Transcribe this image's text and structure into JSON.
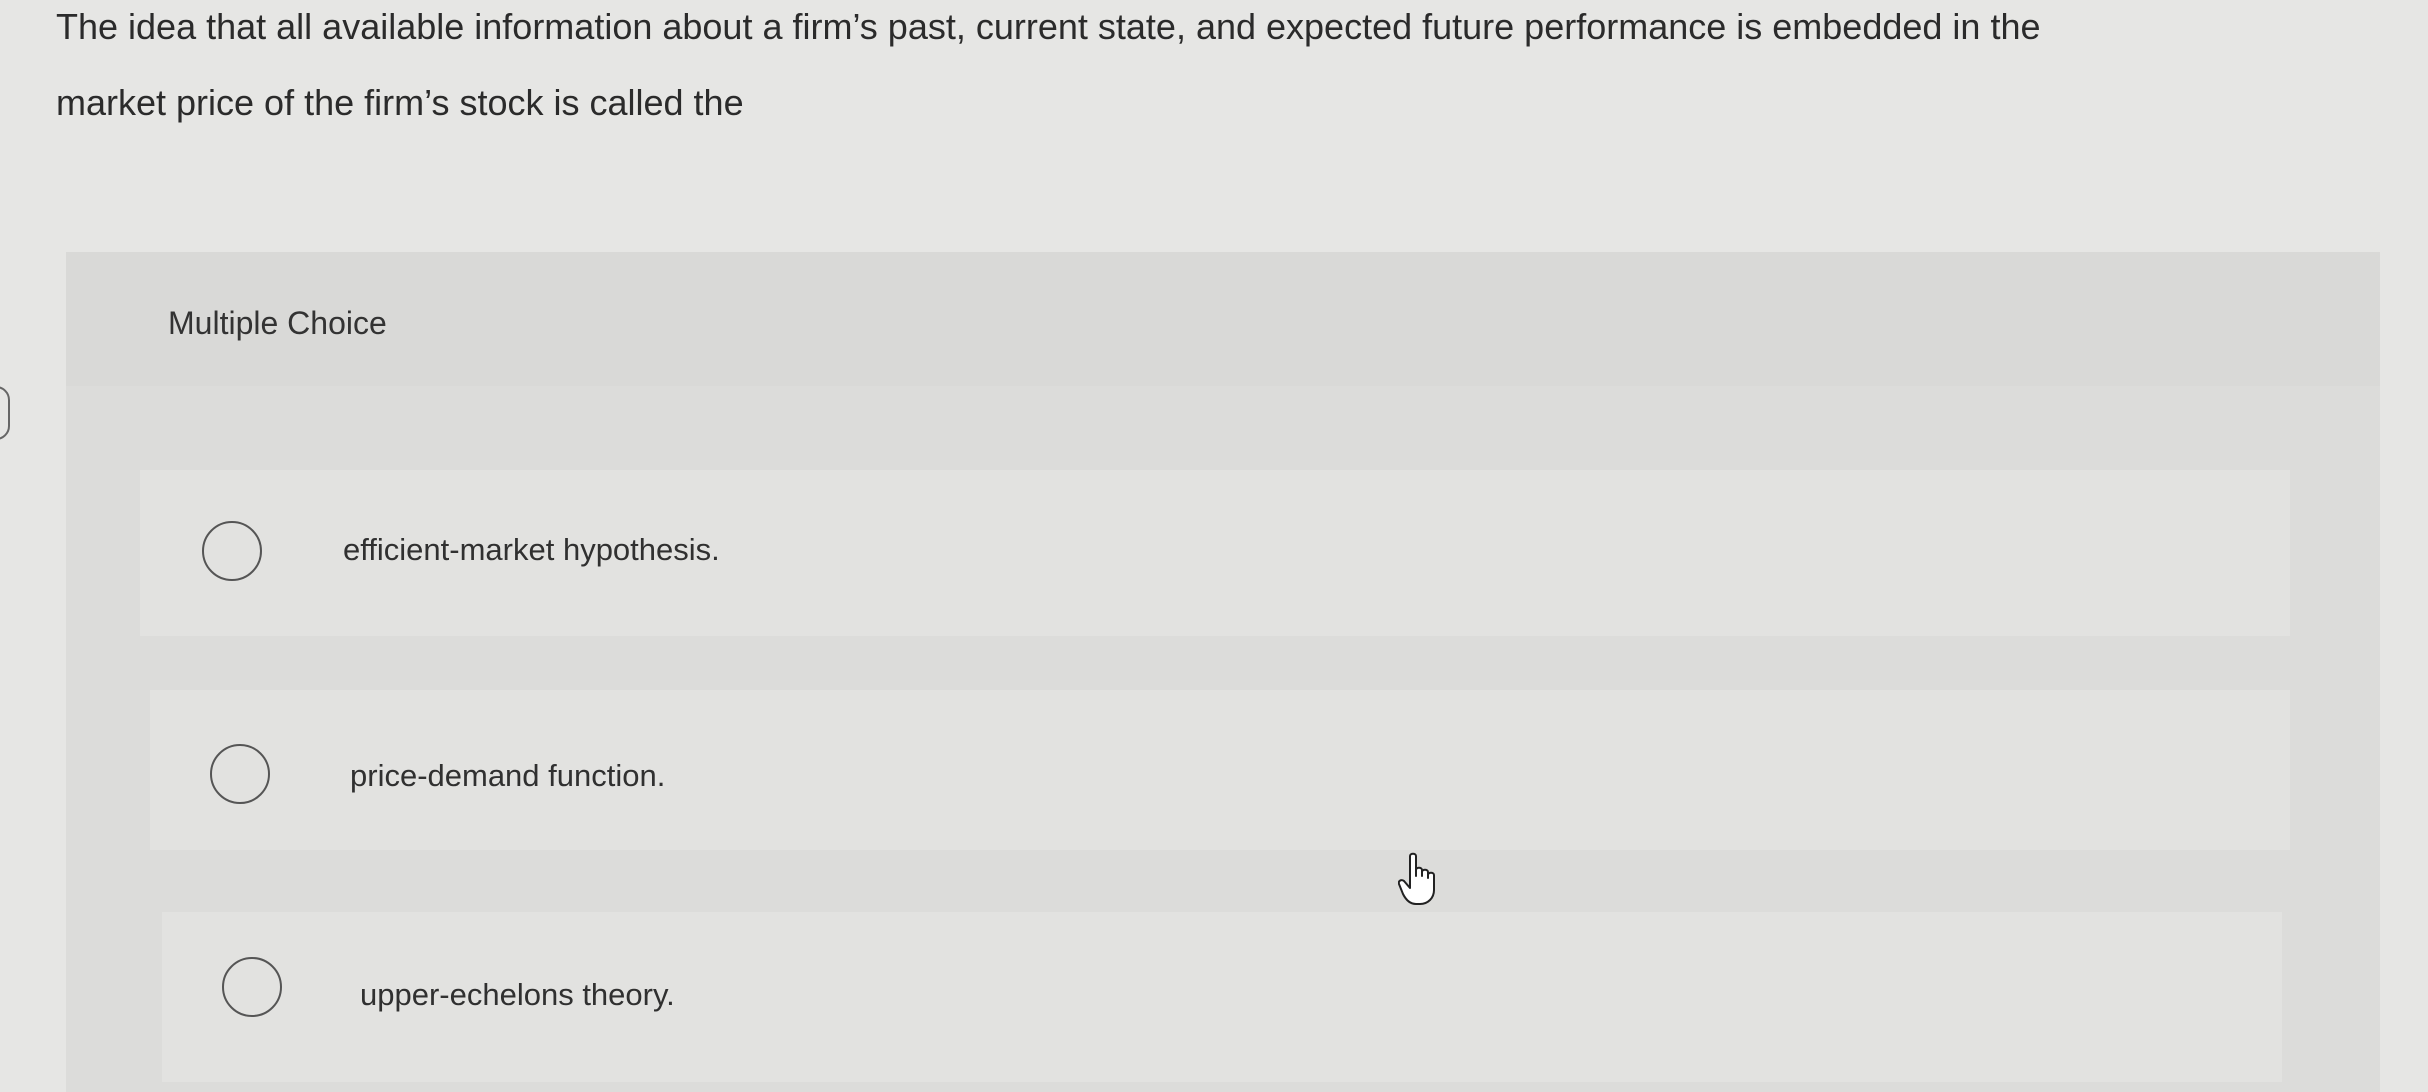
{
  "question": {
    "line1": "The idea that all available information about a firm’s past, current state, and expected future performance is embedded in the",
    "line2": "market price of the firm’s stock is called the"
  },
  "panel": {
    "title": "Multiple Choice",
    "options": [
      {
        "label": "efficient-market hypothesis.",
        "selected": false
      },
      {
        "label": "price-demand function.",
        "selected": false
      },
      {
        "label": "upper-echelons theory.",
        "selected": false
      }
    ]
  },
  "cursor": {
    "icon": "hand-pointer-icon"
  }
}
